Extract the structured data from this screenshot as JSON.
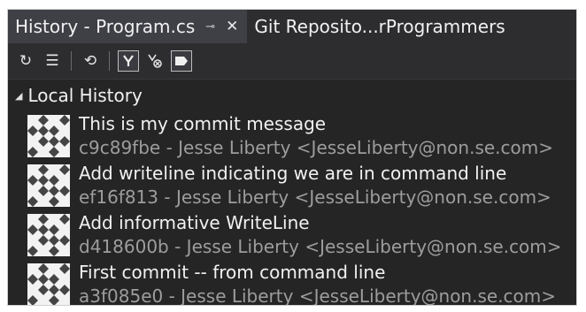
{
  "tabs": [
    {
      "label": "History - Program.cs",
      "active": true
    },
    {
      "label": "Git Reposito...rProgrammers",
      "active": false
    }
  ],
  "tab_icons": {
    "pin": "pin-icon",
    "close": "close-icon"
  },
  "toolbar": [
    {
      "icon": "refresh-icon",
      "glyph": "↻"
    },
    {
      "icon": "list-view-icon",
      "glyph": "☰"
    },
    {
      "icon": "history-icon",
      "glyph": "⟲"
    },
    {
      "icon": "graph-view-icon",
      "glyph": "⑂"
    },
    {
      "icon": "branch-compare-icon",
      "glyph": "⊗"
    },
    {
      "icon": "tag-icon",
      "glyph": "■"
    }
  ],
  "group": {
    "label": "Local History",
    "expanded": true
  },
  "commits": [
    {
      "message": "This is my commit message",
      "meta": "c9c89fbe - Jesse Liberty <JesseLiberty@non.se.com>"
    },
    {
      "message": "Add writeline indicating we are in command line",
      "meta": "ef16f813 - Jesse Liberty <JesseLiberty@non.se.com>"
    },
    {
      "message": "Add informative WriteLine",
      "meta": "d418600b - Jesse Liberty <JesseLiberty@non.se.com>"
    },
    {
      "message": "First commit -- from command line",
      "meta": "a3f085e0 - Jesse Liberty <JesseLiberty@non.se.com>"
    }
  ],
  "colors": {
    "background": "#252526",
    "text": "#f1f1f1",
    "meta_text": "#9d9d9d",
    "tab_active": "#3f3f46"
  }
}
